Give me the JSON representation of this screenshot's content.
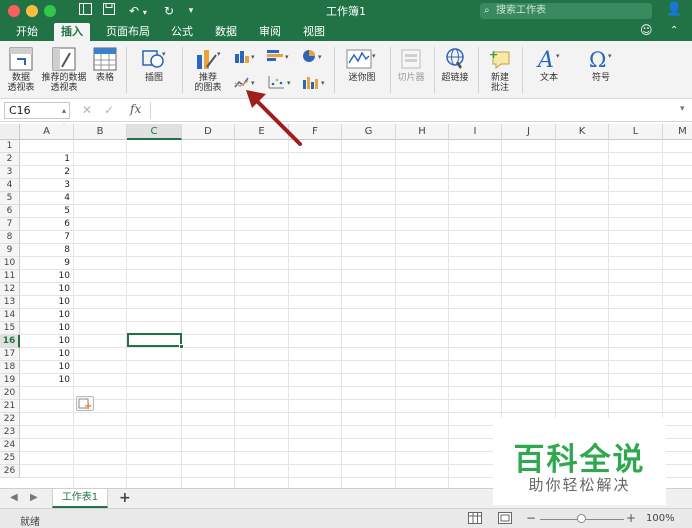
{
  "window": {
    "title": "工作簿1",
    "search_placeholder": "搜索工作表"
  },
  "menu_tabs": [
    {
      "label": "开始",
      "active": false
    },
    {
      "label": "插入",
      "active": true
    },
    {
      "label": "页面布局",
      "active": false
    },
    {
      "label": "公式",
      "active": false
    },
    {
      "label": "数据",
      "active": false
    },
    {
      "label": "审阅",
      "active": false
    },
    {
      "label": "视图",
      "active": false
    }
  ],
  "ribbon": {
    "pivot_table": "数据\n透视表",
    "recommended_pivot": "推荐的数据\n透视表",
    "table": "表格",
    "illustrations": "插图",
    "recommended_charts": "推荐\n的图表",
    "sparklines": "迷你图",
    "slicer": "切片器",
    "hyperlink": "超链接",
    "new_comment": "新建\n批注",
    "text": "文本",
    "symbol": "符号"
  },
  "formula_bar": {
    "name_box": "C16",
    "fx_label": "fx",
    "formula": ""
  },
  "grid": {
    "columns": [
      "A",
      "B",
      "C",
      "D",
      "E",
      "F",
      "G",
      "H",
      "I",
      "J",
      "K",
      "L",
      "M"
    ],
    "rows": [
      "1",
      "2",
      "3",
      "4",
      "5",
      "6",
      "7",
      "8",
      "9",
      "10",
      "11",
      "12",
      "13",
      "14",
      "15",
      "16",
      "17",
      "18",
      "19",
      "20",
      "21",
      "22",
      "23",
      "24",
      "25",
      "26"
    ],
    "column_a_values": [
      "",
      "1",
      "2",
      "3",
      "4",
      "5",
      "6",
      "7",
      "8",
      "9",
      "10",
      "10",
      "10",
      "10",
      "10",
      "10",
      "10",
      "10",
      "10"
    ],
    "selected_column": "C",
    "selected_row": "16"
  },
  "sheets": {
    "active_sheet": "工作表1",
    "add_label": "+"
  },
  "status": {
    "state": "就绪",
    "zoom": "100%",
    "zoom_level": 0.5
  },
  "watermark": {
    "title": "百科全说",
    "subtitle": "助你轻松解决"
  },
  "colors": {
    "accent": "#217346",
    "watermark_green": "#2fa84f",
    "annotation_arrow": "#a01e1e"
  }
}
